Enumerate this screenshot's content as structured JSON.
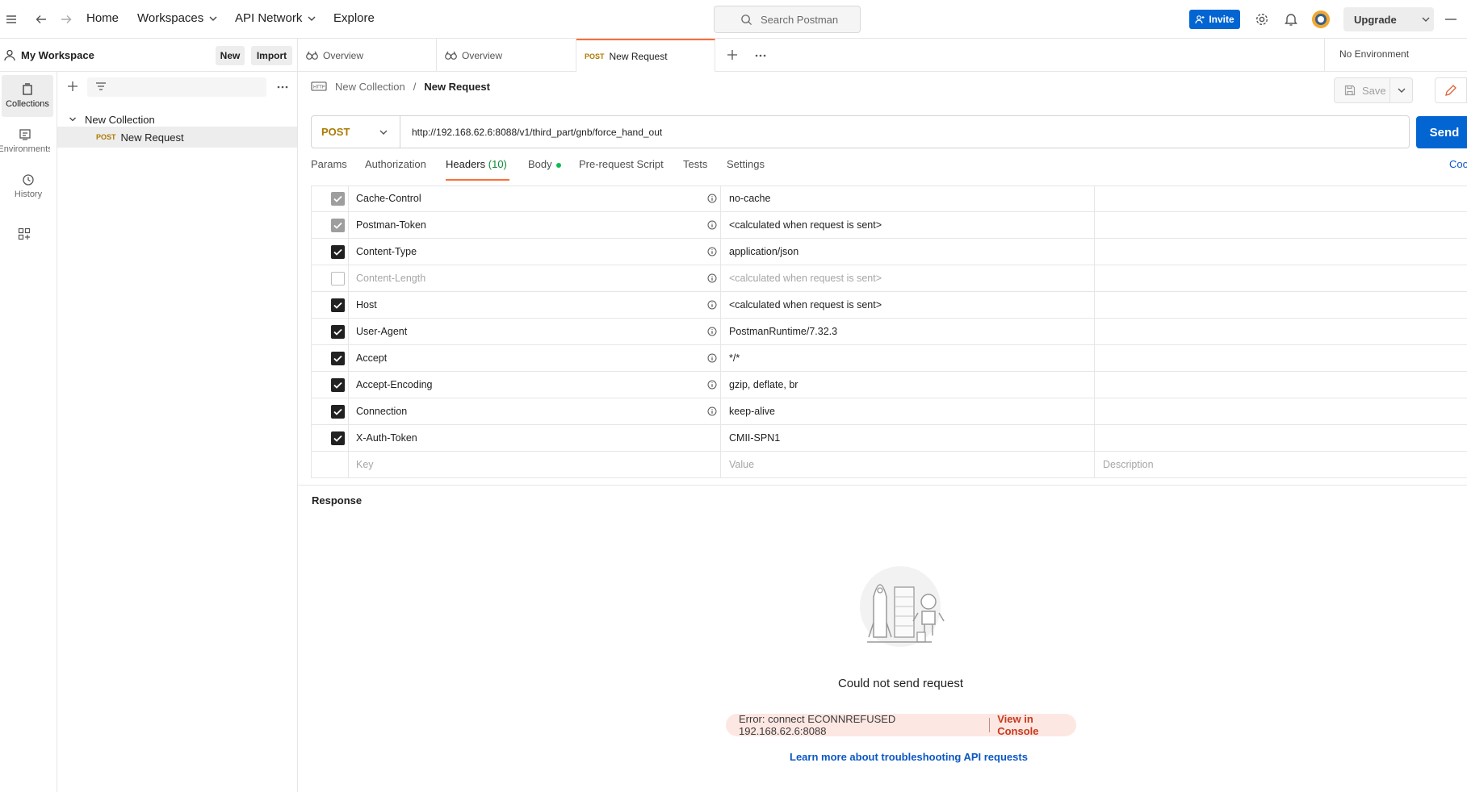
{
  "topbar": {
    "home": "Home",
    "workspaces": "Workspaces",
    "api_network": "API Network",
    "explore": "Explore",
    "search_placeholder": "Search Postman",
    "invite": "Invite",
    "upgrade": "Upgrade"
  },
  "workspace": {
    "name": "My Workspace",
    "new_label": "New",
    "import_label": "Import"
  },
  "tabs": [
    {
      "label": "Overview"
    },
    {
      "label": "Overview"
    },
    {
      "method": "POST",
      "label": "New Request"
    }
  ],
  "environment": "No Environment",
  "rail": {
    "collections": "Collections",
    "environments": "Environments",
    "history": "History"
  },
  "sidebar": {
    "collection_name": "New Collection",
    "request_method": "POST",
    "request_name": "New Request"
  },
  "breadcrumb": {
    "collection": "New Collection",
    "separator": "/",
    "request": "New Request"
  },
  "request": {
    "method": "POST",
    "url": "http://192.168.62.6:8088/v1/third_part/gnb/force_hand_out",
    "send": "Send",
    "save": "Save"
  },
  "request_tabs": {
    "params": "Params",
    "authorization": "Authorization",
    "headers": "Headers",
    "headers_count": "(10)",
    "body": "Body",
    "pre_request": "Pre-request Script",
    "tests": "Tests",
    "settings": "Settings",
    "cookies": "Coo"
  },
  "headers": [
    {
      "key": "Cache-Control",
      "value": "no-cache",
      "state": "grey",
      "info": true
    },
    {
      "key": "Postman-Token",
      "value": "<calculated when request is sent>",
      "state": "grey",
      "info": true
    },
    {
      "key": "Content-Type",
      "value": "application/json",
      "state": "on",
      "info": true
    },
    {
      "key": "Content-Length",
      "value": "<calculated when request is sent>",
      "state": "off",
      "info": true
    },
    {
      "key": "Host",
      "value": "<calculated when request is sent>",
      "state": "on",
      "info": true
    },
    {
      "key": "User-Agent",
      "value": "PostmanRuntime/7.32.3",
      "state": "on",
      "info": true
    },
    {
      "key": "Accept",
      "value": "*/*",
      "state": "on",
      "info": true
    },
    {
      "key": "Accept-Encoding",
      "value": "gzip, deflate, br",
      "state": "on",
      "info": true
    },
    {
      "key": "Connection",
      "value": "keep-alive",
      "state": "on",
      "info": true
    },
    {
      "key": "X-Auth-Token",
      "value": "CMII-SPN1",
      "state": "on",
      "info": false
    }
  ],
  "headers_placeholder": {
    "key": "Key",
    "value": "Value",
    "description": "Description"
  },
  "response": {
    "title": "Response",
    "error_title": "Could not send request",
    "error_message": "Error: connect ECONNREFUSED 192.168.62.6:8088",
    "view_console": "View in Console",
    "learn_more": "Learn more about troubleshooting API requests"
  },
  "colors": {
    "accent": "#ff6c37",
    "primary": "#0265d2",
    "post_method": "#ad7a03",
    "error": "#c53a1c"
  }
}
